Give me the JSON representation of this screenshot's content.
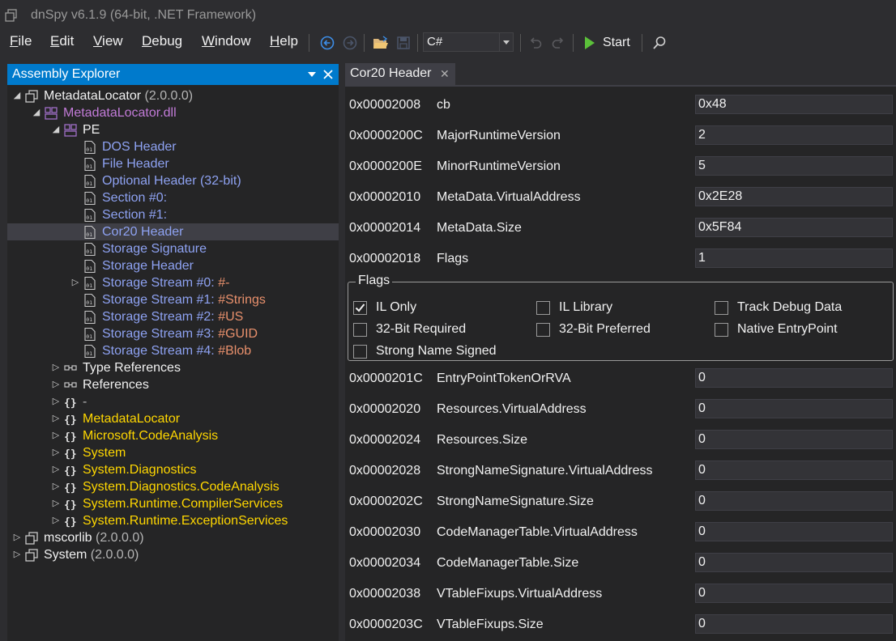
{
  "window": {
    "title": "dnSpy v6.1.9 (64-bit, .NET Framework)"
  },
  "menu": [
    {
      "pre": "",
      "key": "F",
      "post": "ile"
    },
    {
      "pre": "",
      "key": "E",
      "post": "dit"
    },
    {
      "pre": "",
      "key": "V",
      "post": "iew"
    },
    {
      "pre": "",
      "key": "D",
      "post": "ebug"
    },
    {
      "pre": "",
      "key": "W",
      "post": "indow"
    },
    {
      "pre": "",
      "key": "H",
      "post": "elp"
    }
  ],
  "toolbar": {
    "language": "C#",
    "start_label": "Start"
  },
  "explorer": {
    "title": "Assembly Explorer",
    "tree": [
      {
        "label": "MetadataLocator",
        "suffix": " (2.0.0.0)",
        "label_color": "white",
        "suffix_color": "gray",
        "icon": "assembly-icon",
        "expander": "expanded",
        "depth": 0
      },
      {
        "label": "MetadataLocator.dll",
        "suffix": "",
        "label_color": "purple",
        "icon": "module-icon",
        "expander": "expanded",
        "depth": 1
      },
      {
        "label": "PE",
        "suffix": "",
        "label_color": "white",
        "icon": "module-icon",
        "expander": "expanded",
        "depth": 2
      },
      {
        "label": "DOS Header",
        "suffix": "",
        "label_color": "blue",
        "icon": "binary-file-icon",
        "expander": "none",
        "depth": 3
      },
      {
        "label": "File Header",
        "suffix": "",
        "label_color": "blue",
        "icon": "binary-file-icon",
        "expander": "none",
        "depth": 3
      },
      {
        "label": "Optional Header (32-bit)",
        "suffix": "",
        "label_color": "blue",
        "icon": "binary-file-icon",
        "expander": "none",
        "depth": 3
      },
      {
        "label": "Section #0:",
        "suffix": "",
        "label_color": "blue",
        "icon": "binary-file-icon",
        "expander": "none",
        "depth": 3
      },
      {
        "label": "Section #1:",
        "suffix": "",
        "label_color": "blue",
        "icon": "binary-file-icon",
        "expander": "none",
        "depth": 3
      },
      {
        "label": "Cor20 Header",
        "suffix": "",
        "label_color": "blue",
        "icon": "binary-file-icon",
        "expander": "none",
        "depth": 3,
        "selected": true
      },
      {
        "label": "Storage Signature",
        "suffix": "",
        "label_color": "blue",
        "icon": "binary-file-icon",
        "expander": "none",
        "depth": 3
      },
      {
        "label": "Storage Header",
        "suffix": "",
        "label_color": "blue",
        "icon": "binary-file-icon",
        "expander": "none",
        "depth": 3
      },
      {
        "label": "Storage Stream #0: ",
        "suffix": "#-",
        "label_color": "blue",
        "suffix_color": "orange",
        "icon": "binary-file-icon",
        "expander": "collapsed",
        "depth": 3
      },
      {
        "label": "Storage Stream #1: ",
        "suffix": "#Strings",
        "label_color": "blue",
        "suffix_color": "orange",
        "icon": "binary-file-icon",
        "expander": "none",
        "depth": 3
      },
      {
        "label": "Storage Stream #2: ",
        "suffix": "#US",
        "label_color": "blue",
        "suffix_color": "orange",
        "icon": "binary-file-icon",
        "expander": "none",
        "depth": 3
      },
      {
        "label": "Storage Stream #3: ",
        "suffix": "#GUID",
        "label_color": "blue",
        "suffix_color": "orange",
        "icon": "binary-file-icon",
        "expander": "none",
        "depth": 3
      },
      {
        "label": "Storage Stream #4: ",
        "suffix": "#Blob",
        "label_color": "blue",
        "suffix_color": "orange",
        "icon": "binary-file-icon",
        "expander": "none",
        "depth": 3
      },
      {
        "label": "Type References",
        "suffix": "",
        "label_color": "white",
        "icon": "references-icon",
        "expander": "collapsed",
        "depth": 2
      },
      {
        "label": "References",
        "suffix": "",
        "label_color": "white",
        "icon": "references-icon",
        "expander": "collapsed",
        "depth": 2
      },
      {
        "label": "-",
        "suffix": "",
        "label_color": "gray",
        "icon": "namespace-icon",
        "expander": "collapsed",
        "depth": 2
      },
      {
        "label": "MetadataLocator",
        "suffix": "",
        "label_color": "yellow",
        "icon": "namespace-icon",
        "expander": "collapsed",
        "depth": 2
      },
      {
        "label": "Microsoft.CodeAnalysis",
        "suffix": "",
        "label_color": "yellow",
        "icon": "namespace-icon",
        "expander": "collapsed",
        "depth": 2
      },
      {
        "label": "System",
        "suffix": "",
        "label_color": "yellow",
        "icon": "namespace-icon",
        "expander": "collapsed",
        "depth": 2
      },
      {
        "label": "System.Diagnostics",
        "suffix": "",
        "label_color": "yellow",
        "icon": "namespace-icon",
        "expander": "collapsed",
        "depth": 2
      },
      {
        "label": "System.Diagnostics.CodeAnalysis",
        "suffix": "",
        "label_color": "yellow",
        "icon": "namespace-icon",
        "expander": "collapsed",
        "depth": 2
      },
      {
        "label": "System.Runtime.CompilerServices",
        "suffix": "",
        "label_color": "yellow",
        "icon": "namespace-icon",
        "expander": "collapsed",
        "depth": 2
      },
      {
        "label": "System.Runtime.ExceptionServices",
        "suffix": "",
        "label_color": "yellow",
        "icon": "namespace-icon",
        "expander": "collapsed",
        "depth": 2
      },
      {
        "label": "mscorlib",
        "suffix": " (2.0.0.0)",
        "label_color": "white",
        "suffix_color": "gray",
        "icon": "assembly-icon",
        "expander": "collapsed",
        "depth": 0
      },
      {
        "label": "System",
        "suffix": " (2.0.0.0)",
        "label_color": "white",
        "suffix_color": "gray",
        "icon": "assembly-icon",
        "expander": "collapsed",
        "depth": 0
      }
    ]
  },
  "document_tab": {
    "label": "Cor20 Header"
  },
  "fields_top": [
    {
      "offset": "0x00002008",
      "name": "cb",
      "value": "0x48"
    },
    {
      "offset": "0x0000200C",
      "name": "MajorRuntimeVersion",
      "value": "2"
    },
    {
      "offset": "0x0000200E",
      "name": "MinorRuntimeVersion",
      "value": "5"
    },
    {
      "offset": "0x00002010",
      "name": "MetaData.VirtualAddress",
      "value": "0x2E28"
    },
    {
      "offset": "0x00002014",
      "name": "MetaData.Size",
      "value": "0x5F84"
    },
    {
      "offset": "0x00002018",
      "name": "Flags",
      "value": "1"
    }
  ],
  "flags_group": {
    "legend": "Flags",
    "items": [
      {
        "label": "IL Only",
        "checked": true
      },
      {
        "label": "IL Library",
        "checked": false
      },
      {
        "label": "Track Debug Data",
        "checked": false
      },
      {
        "label": "32-Bit Required",
        "checked": false
      },
      {
        "label": "32-Bit Preferred",
        "checked": false
      },
      {
        "label": "Native EntryPoint",
        "checked": false
      },
      {
        "label": "Strong Name Signed",
        "checked": false
      }
    ]
  },
  "fields_bottom": [
    {
      "offset": "0x0000201C",
      "name": "EntryPointTokenOrRVA",
      "value": "0"
    },
    {
      "offset": "0x00002020",
      "name": "Resources.VirtualAddress",
      "value": "0"
    },
    {
      "offset": "0x00002024",
      "name": "Resources.Size",
      "value": "0"
    },
    {
      "offset": "0x00002028",
      "name": "StrongNameSignature.VirtualAddress",
      "value": "0"
    },
    {
      "offset": "0x0000202C",
      "name": "StrongNameSignature.Size",
      "value": "0"
    },
    {
      "offset": "0x00002030",
      "name": "CodeManagerTable.VirtualAddress",
      "value": "0"
    },
    {
      "offset": "0x00002034",
      "name": "CodeManagerTable.Size",
      "value": "0"
    },
    {
      "offset": "0x00002038",
      "name": "VTableFixups.VirtualAddress",
      "value": "0"
    },
    {
      "offset": "0x0000203C",
      "name": "VTableFixups.Size",
      "value": "0"
    }
  ],
  "colors": {
    "accent": "#007acc",
    "background": "#2d2d30",
    "panel": "#252526",
    "selection": "#3f3f46"
  }
}
